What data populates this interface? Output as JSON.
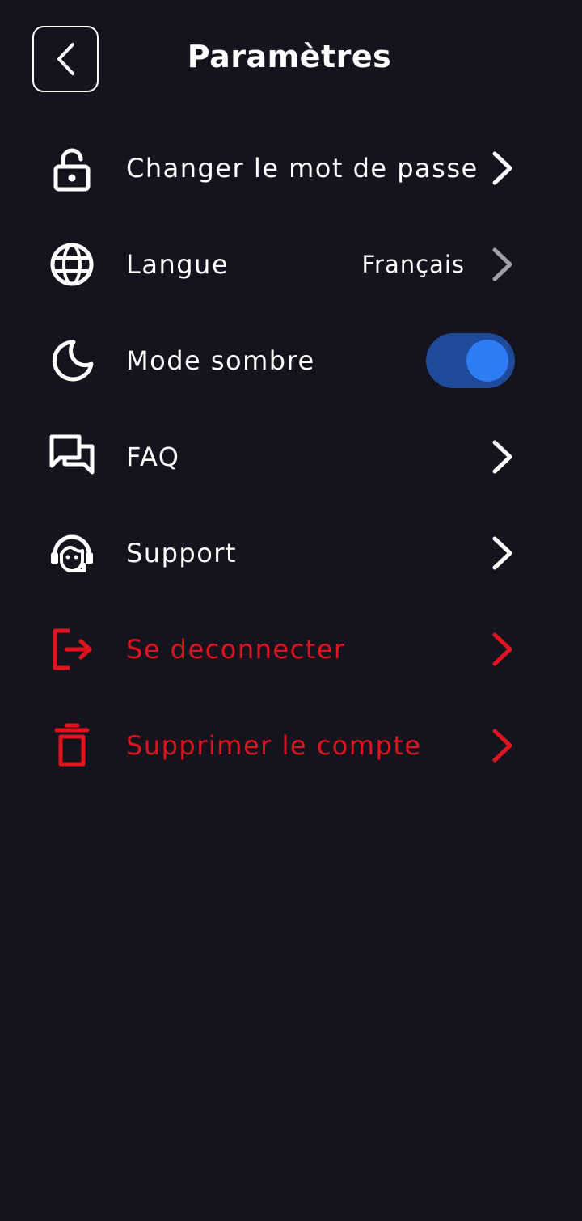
{
  "header": {
    "title": "Paramètres",
    "back_icon": "chevron-left-icon"
  },
  "menu": {
    "change_password": {
      "label": "Changer le mot de passe",
      "icon": "lock-open-icon"
    },
    "language": {
      "label": "Langue",
      "value": "Français",
      "icon": "globe-icon"
    },
    "dark_mode": {
      "label": "Mode sombre",
      "icon": "moon-icon",
      "enabled": true
    },
    "faq": {
      "label": "FAQ",
      "icon": "chat-bubbles-icon"
    },
    "support": {
      "label": "Support",
      "icon": "headset-icon"
    },
    "logout": {
      "label": "Se deconnecter",
      "icon": "logout-icon"
    },
    "delete_account": {
      "label": "Supprimer le compte",
      "icon": "trash-icon"
    }
  },
  "colors": {
    "background": "#15141e",
    "text": "#ffffff",
    "danger": "#e0141e",
    "toggle_track": "#1f4999",
    "toggle_knob": "#2e7cf6",
    "chevron_muted": "#a0a0a8"
  }
}
